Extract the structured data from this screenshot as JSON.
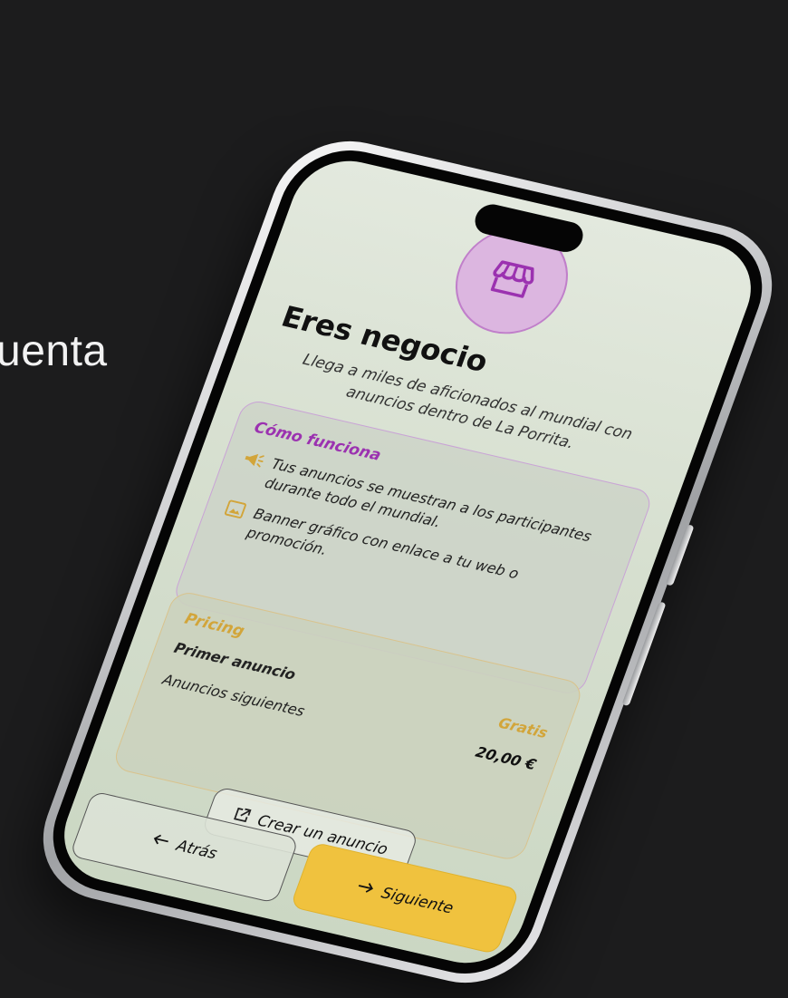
{
  "background_text": "uenta",
  "screen": {
    "hero_icon": "storefront-icon",
    "title": "Eres negocio",
    "subtitle": "Llega a miles de aficionados al mundial con anuncios dentro de La Porrita.",
    "how_it_works": {
      "title": "Cómo funciona",
      "items": [
        {
          "icon": "megaphone-icon",
          "text": "Tus anuncios se muestran a los participantes durante todo el mundial."
        },
        {
          "icon": "image-icon",
          "text": "Banner gráfico con enlace a tu web o promoción."
        }
      ]
    },
    "pricing": {
      "title": "Pricing",
      "rows": [
        {
          "label": "Primer anuncio",
          "value": "Gratis"
        },
        {
          "label": "Anuncios siguientes",
          "value": "20,00 €"
        }
      ]
    },
    "create_button": {
      "label": "Crear un anuncio",
      "icon": "external-link-icon"
    },
    "nav": {
      "back_label": "Atrás",
      "back_icon": "arrow-left-icon",
      "next_label": "Siguiente",
      "next_icon": "arrow-right-icon"
    }
  },
  "colors": {
    "accent_purple": "#9b32b0",
    "accent_gold": "#d2a53a",
    "next_button": "#f0c23e",
    "background": "#1c1c1d"
  }
}
